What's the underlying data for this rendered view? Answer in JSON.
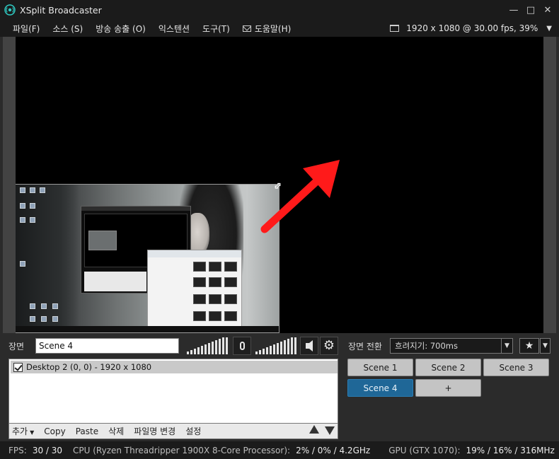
{
  "window": {
    "title": "XSplit Broadcaster",
    "minimize": "—",
    "maximize": "□",
    "close": "✕"
  },
  "menu": {
    "items": [
      "파일(F)",
      "소스 (S)",
      "방송 송출 (O)",
      "익스텐션",
      "도구(T)"
    ],
    "help": "도움말(H)",
    "resolution": "1920 x 1080 @ 30.00 fps, 39%",
    "resolution_caret": "▼"
  },
  "preview": {
    "resize_handle": "⇔",
    "arrow_color": "#ff1a1a"
  },
  "scene": {
    "label": "장면",
    "name_value": "Scene 4"
  },
  "sources": {
    "items": [
      {
        "label": "Desktop 2 (0, 0) - 1920 x 1080",
        "checked": true
      }
    ],
    "toolbar": {
      "add": "추가",
      "copy": "Copy",
      "paste": "Paste",
      "delete": "삭제",
      "rename": "파일명 변경",
      "settings": "설정"
    }
  },
  "transition": {
    "label": "장면 전환",
    "value": "흐려지기: 700ms",
    "caret": "▼",
    "fav_icon": "★"
  },
  "scenes": {
    "buttons": [
      "Scene 1",
      "Scene 2",
      "Scene 3",
      "Scene 4",
      "+"
    ],
    "active": "Scene 4",
    "active_color": "#1f6797"
  },
  "status": {
    "fps_label": "FPS:",
    "fps_value": "30 / 30",
    "cpu_label": "CPU (Ryzen Threadripper 1900X 8-Core Processor):",
    "cpu_value": "2% / 0% / 4.2GHz",
    "gpu_label": "GPU (GTX 1070):",
    "gpu_value": "19% / 16% / 316MHz"
  }
}
